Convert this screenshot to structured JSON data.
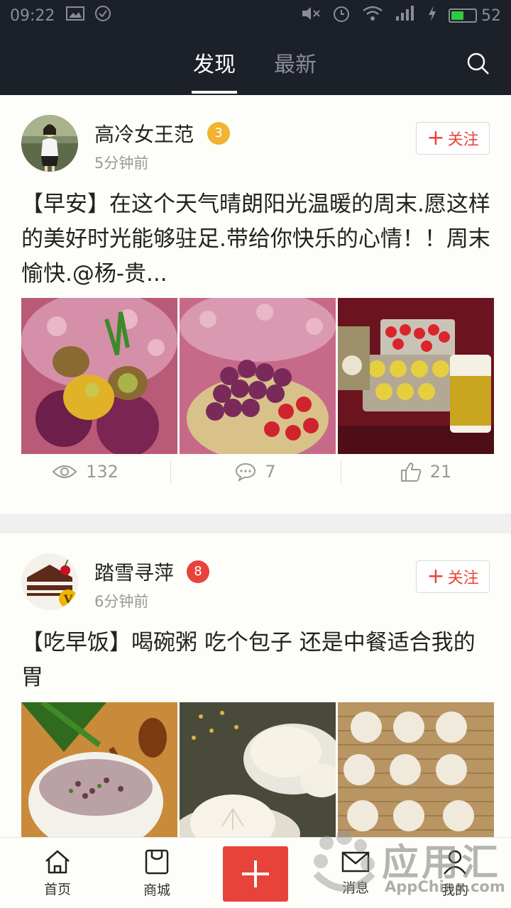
{
  "status_bar": {
    "time": "09:22",
    "battery": "52",
    "battery_level": 0.52
  },
  "nav": {
    "tabs": [
      "发现",
      "最新"
    ],
    "active_tab": "发现"
  },
  "posts": [
    {
      "username": "高冷女王范",
      "level": "3",
      "level_color": "#f2b331",
      "timestamp": "5分钟前",
      "follow_label": "关注",
      "text": "【早安】在这个天气晴朗阳光温暖的周末.愿这样的美好时光能够驻足.带给你快乐的心情！！周末愉快.@杨-贵...",
      "images": [
        "fruit-plate-photo",
        "grapes-strawberries-photo",
        "shumai-breakfast-photo"
      ],
      "views": "132",
      "comments": "7",
      "likes": "21"
    },
    {
      "username": "踏雪寻萍",
      "level": "8",
      "level_color": "#e8433a",
      "timestamp": "6分钟前",
      "follow_label": "关注",
      "text": "【吃早饭】喝碗粥 吃个包子 还是中餐适合我的胃",
      "images": [
        "congee-bowl-photo",
        "steamed-buns-photo",
        "dumplings-tray-photo"
      ]
    }
  ],
  "bottom_nav": {
    "home": "首页",
    "mall": "商城",
    "messages": "消息",
    "me": "我的"
  },
  "watermark": {
    "brand": "应用汇",
    "site": "AppChina.com"
  },
  "colors": {
    "accent": "#e8433a",
    "header_bg": "#1c2029"
  }
}
